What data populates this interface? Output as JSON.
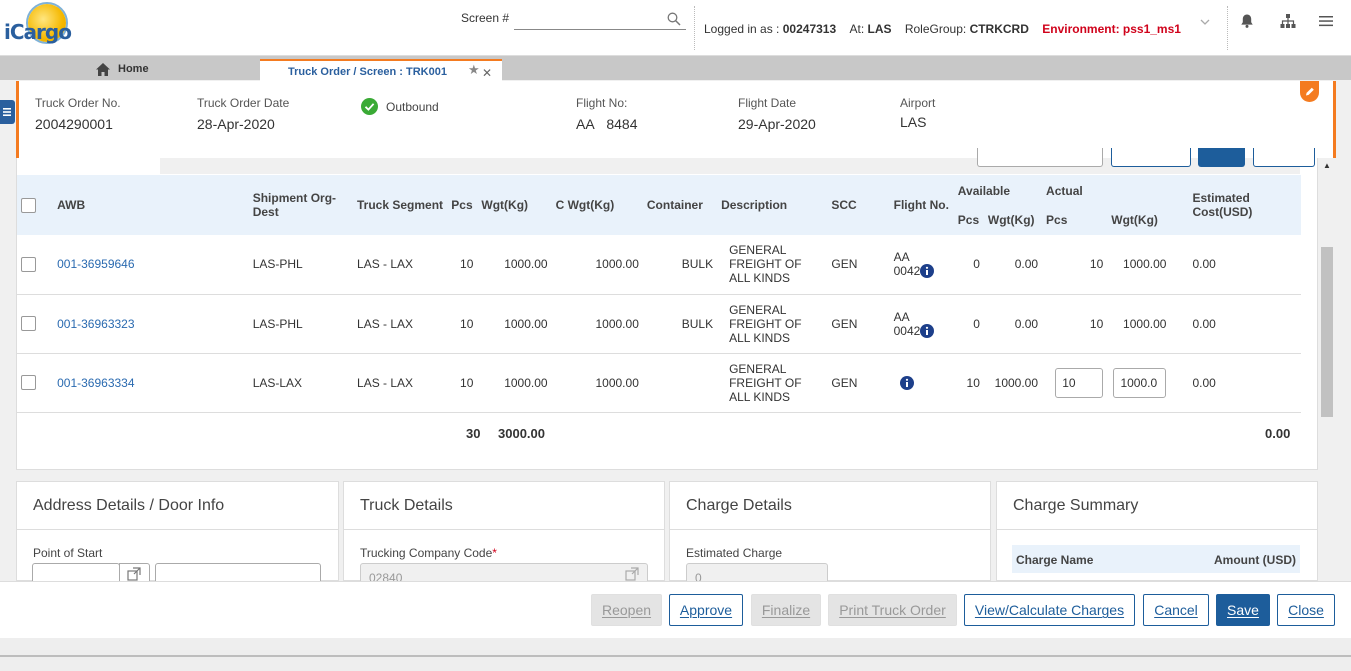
{
  "app": {
    "logo_text": "iCargo"
  },
  "topbar": {
    "screen_label": "Screen #",
    "screen_value": "",
    "logged_in_label": "Logged in as :",
    "user_id": "00247313",
    "at_label": "At:",
    "station": "LAS",
    "rolegroup_label": "RoleGroup:",
    "rolegroup": "CTRKCRD",
    "environment": "Environment: pss1_ms1"
  },
  "tabs": {
    "home_label": "Home",
    "active_label": "Truck Order / Screen : TRK001"
  },
  "header": {
    "truck_order_no_label": "Truck Order No.",
    "truck_order_no": "2004290001",
    "truck_order_date_label": "Truck Order Date",
    "truck_order_date": "28-Apr-2020",
    "direction": "Outbound",
    "flight_no_label": "Flight No:",
    "flight_carrier": "AA",
    "flight_number": "8484",
    "flight_date_label": "Flight Date",
    "flight_date": "29-Apr-2020",
    "airport_label": "Airport",
    "airport": "LAS"
  },
  "grid": {
    "columns": {
      "awb": "AWB",
      "shipment": "Shipment Org-Dest",
      "truck_segment": "Truck Segment",
      "pcs": "Pcs",
      "wgt": "Wgt(Kg)",
      "cwgt": "C Wgt(Kg)",
      "container": "Container",
      "description": "Description",
      "scc": "SCC",
      "flight_no": "Flight No.",
      "available": "Available",
      "actual": "Actual",
      "avail_pcs": "Pcs",
      "avail_wgt": "Wgt(Kg)",
      "act_pcs": "Pcs",
      "act_wgt": "Wgt(Kg)",
      "est_cost": "Estimated Cost(USD)"
    },
    "rows": [
      {
        "awb": "001-36959646",
        "shipment": "LAS-PHL",
        "segment": "LAS - LAX",
        "pcs": "10",
        "wgt": "1000.00",
        "cwgt": "1000.00",
        "container": "BULK",
        "description": "GENERAL FREIGHT OF ALL KINDS",
        "scc": "GEN",
        "flight": "AA 0042",
        "avail_pcs": "0",
        "avail_wgt": "0.00",
        "act_pcs": "10",
        "act_wgt": "1000.00",
        "cost": "0.00"
      },
      {
        "awb": "001-36963323",
        "shipment": "LAS-PHL",
        "segment": "LAS - LAX",
        "pcs": "10",
        "wgt": "1000.00",
        "cwgt": "1000.00",
        "container": "BULK",
        "description": "GENERAL FREIGHT OF ALL KINDS",
        "scc": "GEN",
        "flight": "AA 0042",
        "avail_pcs": "0",
        "avail_wgt": "0.00",
        "act_pcs": "10",
        "act_wgt": "1000.00",
        "cost": "0.00"
      },
      {
        "awb": "001-36963334",
        "shipment": "LAS-LAX",
        "segment": "LAS - LAX",
        "pcs": "10",
        "wgt": "1000.00",
        "cwgt": "1000.00",
        "container": "",
        "description": "GENERAL FREIGHT OF ALL KINDS",
        "scc": "GEN",
        "flight": "",
        "avail_pcs": "10",
        "avail_wgt": "1000.00",
        "act_pcs": "10",
        "act_wgt": "1000.0",
        "cost": "0.00"
      }
    ],
    "totals": {
      "pcs": "30",
      "wgt": "3000.00",
      "cost": "0.00"
    }
  },
  "panels": {
    "address": {
      "title": "Address Details / Door Info",
      "point_of_start_label": "Point of Start"
    },
    "truck": {
      "title": "Truck Details",
      "company_code_label": "Trucking Company Code",
      "required_mark": "*",
      "company_code": "02840"
    },
    "charge": {
      "title": "Charge Details",
      "estimated_charge_label": "Estimated Charge",
      "estimated_charge": "0"
    },
    "summary": {
      "title": "Charge Summary",
      "col_name": "Charge Name",
      "col_amount": "Amount (USD)"
    }
  },
  "footer": {
    "reopen": "Reopen",
    "approve": "Approve",
    "finalize": "Finalize",
    "print": "Print Truck Order",
    "view_calc": "View/Calculate Charges",
    "cancel": "Cancel",
    "save": "Save",
    "close": "Close"
  },
  "colors": {
    "accent": "#f47b20",
    "primary": "#1d5d9b",
    "link": "#2a6ab0",
    "env_red": "#d0021b",
    "grid_header": "#e9f2fb"
  }
}
